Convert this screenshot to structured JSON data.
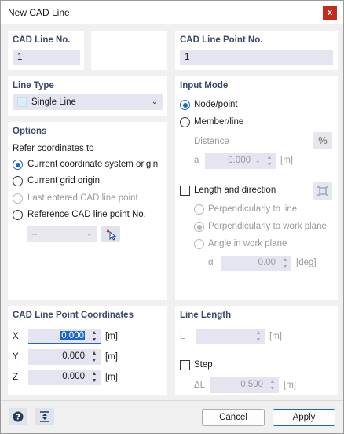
{
  "window": {
    "title": "New CAD Line",
    "close": "x"
  },
  "cad_line_no": {
    "title": "CAD Line No.",
    "value": "1"
  },
  "cad_line_point_no": {
    "title": "CAD Line Point No.",
    "value": "1"
  },
  "line_type": {
    "title": "Line Type",
    "selected": "Single Line"
  },
  "options": {
    "title": "Options",
    "refer_label": "Refer coordinates to",
    "choices": [
      "Current coordinate system origin",
      "Current grid origin",
      "Last entered CAD line point",
      "Reference CAD line point No."
    ],
    "ref_dropdown": "--"
  },
  "input_mode": {
    "title": "Input Mode",
    "node_point": "Node/point",
    "member_line": "Member/line",
    "distance_label": "Distance",
    "percent_btn": "%",
    "a_label": "a",
    "a_value": "0.000",
    "a_unit": "[m]",
    "length_direction": "Length and direction",
    "perp_line": "Perpendicularly to line",
    "perp_plane": "Perpendicularly to work plane",
    "angle_plane": "Angle in work plane",
    "alpha_label": "α",
    "alpha_value": "0.00",
    "alpha_unit": "[deg]"
  },
  "coords": {
    "title": "CAD Line Point Coordinates",
    "rows": [
      {
        "label": "X",
        "value": "0.000",
        "unit": "[m]"
      },
      {
        "label": "Y",
        "value": "0.000",
        "unit": "[m]"
      },
      {
        "label": "Z",
        "value": "0.000",
        "unit": "[m]"
      }
    ]
  },
  "line_length": {
    "title": "Line Length",
    "l_label": "L",
    "l_unit": "[m]",
    "step_label": "Step",
    "dl_label": "ΔL",
    "dl_value": "0.500",
    "dl_unit": "[m]"
  },
  "footer": {
    "cancel": "Cancel",
    "apply": "Apply"
  },
  "colors": {
    "accent": "#1a66c8",
    "field_bg": "#e4e5f0",
    "close_red": "#c42b1c"
  }
}
